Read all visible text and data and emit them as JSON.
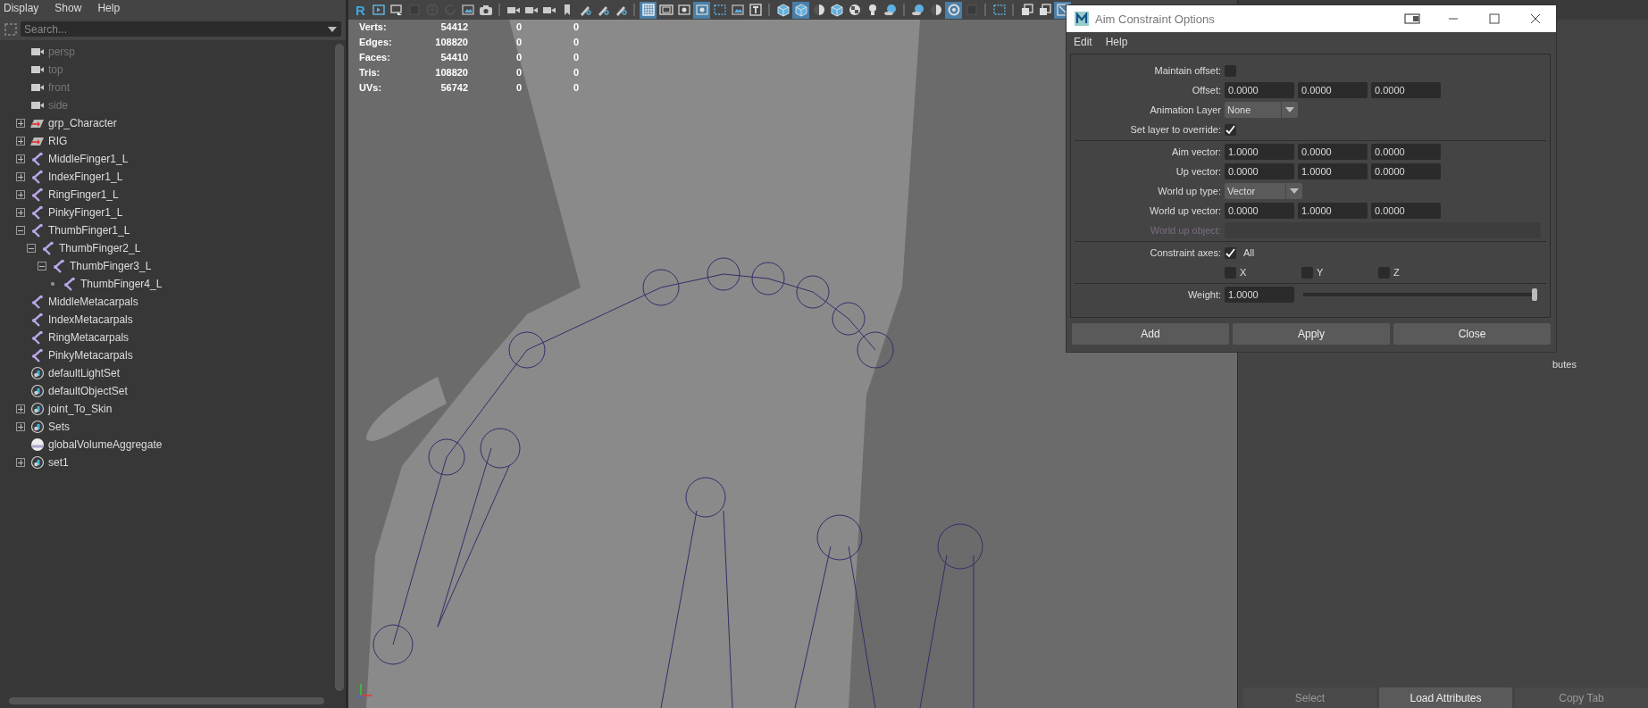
{
  "outliner": {
    "menu": [
      "Display",
      "Show",
      "Help"
    ],
    "search": {
      "placeholder": "Search..."
    },
    "items": [
      {
        "kind": "camera",
        "label": "persp",
        "dimmed": true
      },
      {
        "kind": "camera",
        "label": "top",
        "dimmed": true
      },
      {
        "kind": "camera",
        "label": "front",
        "dimmed": true
      },
      {
        "kind": "camera",
        "label": "side",
        "dimmed": true
      },
      {
        "kind": "group",
        "label": "grp_Character",
        "dimmed": false,
        "expanded": false
      },
      {
        "kind": "group",
        "label": "RIG",
        "dimmed": false,
        "expanded": false
      },
      {
        "kind": "joint",
        "label": "MiddleFinger1_L",
        "dimmed": false,
        "expanded": false
      },
      {
        "kind": "joint",
        "label": "IndexFinger1_L",
        "dimmed": false,
        "expanded": false
      },
      {
        "kind": "joint",
        "label": "RingFinger1_L",
        "dimmed": false,
        "expanded": false
      },
      {
        "kind": "joint",
        "label": "PinkyFinger1_L",
        "dimmed": false,
        "expanded": false
      },
      {
        "kind": "joint",
        "label": "ThumbFinger1_L",
        "dimmed": false,
        "expanded": true,
        "children": [
          {
            "kind": "joint",
            "label": "ThumbFinger2_L",
            "dimmed": false,
            "expanded": true,
            "children": [
              {
                "kind": "joint",
                "label": "ThumbFinger3_L",
                "dimmed": false,
                "expanded": true,
                "children": [
                  {
                    "kind": "joint",
                    "label": "ThumbFinger4_L",
                    "dimmed": false
                  }
                ]
              }
            ]
          }
        ]
      },
      {
        "kind": "joint",
        "label": "MiddleMetacarpals",
        "dimmed": false
      },
      {
        "kind": "joint",
        "label": "IndexMetacarpals",
        "dimmed": false
      },
      {
        "kind": "joint",
        "label": "RingMetacarpals",
        "dimmed": false
      },
      {
        "kind": "joint",
        "label": "PinkyMetacarpals",
        "dimmed": false
      },
      {
        "kind": "set",
        "label": "defaultLightSet",
        "dimmed": false
      },
      {
        "kind": "set",
        "label": "defaultObjectSet",
        "dimmed": false
      },
      {
        "kind": "set",
        "label": "joint_To_Skin",
        "dimmed": false,
        "expanded": false
      },
      {
        "kind": "set",
        "label": "Sets",
        "dimmed": false,
        "expanded": false
      },
      {
        "kind": "volume",
        "label": "globalVolumeAggregate",
        "dimmed": false
      },
      {
        "kind": "set",
        "label": "set1",
        "dimmed": false,
        "expanded": false
      }
    ]
  },
  "viewport": {
    "toolbar": [
      {
        "kind": "glyph",
        "label": "R",
        "selected": false
      },
      {
        "kind": "play",
        "selected": false
      },
      {
        "kind": "monitor",
        "selected": false
      },
      {
        "kind": "square",
        "selected": false
      },
      {
        "kind": "globe",
        "selected": false
      },
      {
        "kind": "refresh",
        "selected": false
      },
      {
        "kind": "image",
        "selected": false
      },
      {
        "kind": "photo",
        "selected": false
      },
      {
        "kind": "sep"
      },
      {
        "kind": "camera",
        "selected": false
      },
      {
        "kind": "camera",
        "selected": false
      },
      {
        "kind": "camera",
        "selected": false
      },
      {
        "kind": "bookmark",
        "selected": false
      },
      {
        "kind": "pen",
        "selected": false
      },
      {
        "kind": "pen",
        "selected": false
      },
      {
        "kind": "pen",
        "selected": false
      },
      {
        "kind": "sep"
      },
      {
        "kind": "grid",
        "selected": true
      },
      {
        "kind": "film",
        "selected": false
      },
      {
        "kind": "circle",
        "selected": false
      },
      {
        "kind": "circle",
        "selected": true
      },
      {
        "kind": "dashed",
        "selected": false
      },
      {
        "kind": "image",
        "selected": false
      },
      {
        "kind": "framed-t",
        "selected": false
      },
      {
        "kind": "sep"
      },
      {
        "kind": "cube",
        "selected": false
      },
      {
        "kind": "cube",
        "selected": true
      },
      {
        "kind": "half",
        "selected": false
      },
      {
        "kind": "cube",
        "selected": false
      },
      {
        "kind": "checker",
        "selected": false
      },
      {
        "kind": "bulb",
        "selected": false
      },
      {
        "kind": "sphere",
        "selected": false
      },
      {
        "kind": "sep"
      },
      {
        "kind": "sphere",
        "selected": false
      },
      {
        "kind": "half",
        "selected": false
      },
      {
        "kind": "ring",
        "selected": true
      },
      {
        "kind": "square",
        "selected": false
      },
      {
        "kind": "sep"
      },
      {
        "kind": "dashed",
        "selected": false
      },
      {
        "kind": "sep"
      },
      {
        "kind": "stack",
        "selected": false
      },
      {
        "kind": "stack",
        "selected": false
      },
      {
        "kind": "frame",
        "selected": true
      }
    ],
    "hud": [
      {
        "label": "Verts:",
        "values": [
          "54412",
          "0",
          "0"
        ]
      },
      {
        "label": "Edges:",
        "values": [
          "108820",
          "0",
          "0"
        ]
      },
      {
        "label": "Faces:",
        "values": [
          "54410",
          "0",
          "0"
        ]
      },
      {
        "label": "Tris:",
        "values": [
          "108820",
          "0",
          "0"
        ]
      },
      {
        "label": "UVs:",
        "values": [
          "56742",
          "0",
          "0"
        ]
      }
    ]
  },
  "right_panel": {
    "partial_label": "butes",
    "buttons": [
      {
        "label": "Select",
        "disabled": true
      },
      {
        "label": "Load Attributes",
        "disabled": false
      },
      {
        "label": "Copy Tab",
        "disabled": true
      }
    ]
  },
  "dialog": {
    "title": "Aim Constraint Options",
    "menu": [
      "Edit",
      "Help"
    ],
    "sections": [
      {
        "rows": [
          {
            "kind": "checkbox",
            "label": "Maintain offset:",
            "checked": false
          },
          {
            "kind": "vector",
            "label": "Offset:",
            "values": [
              "0.0000",
              "0.0000",
              "0.0000"
            ]
          },
          {
            "kind": "dropdown",
            "label": "Animation Layer",
            "value": "None"
          },
          {
            "kind": "checkbox",
            "label": "Set layer to override:",
            "checked": true
          }
        ]
      },
      {
        "rows": [
          {
            "kind": "vector",
            "label": "Aim vector:",
            "values": [
              "1.0000",
              "0.0000",
              "0.0000"
            ]
          },
          {
            "kind": "vector",
            "label": "Up vector:",
            "values": [
              "0.0000",
              "1.0000",
              "0.0000"
            ]
          },
          {
            "kind": "dropdown",
            "label": "World up type:",
            "value": "Vector"
          },
          {
            "kind": "vector",
            "label": "World up vector:",
            "values": [
              "0.0000",
              "1.0000",
              "0.0000"
            ]
          },
          {
            "kind": "object",
            "label": "World up object:",
            "disabled": true
          }
        ]
      },
      {
        "rows": [
          {
            "kind": "checkbox",
            "label": "Constraint axes:",
            "checked": true,
            "option": "All"
          },
          {
            "kind": "axes",
            "options": [
              {
                "label": "X",
                "checked": false
              },
              {
                "label": "Y",
                "checked": false
              },
              {
                "label": "Z",
                "checked": false
              }
            ]
          }
        ]
      },
      {
        "rows": [
          {
            "kind": "slider",
            "label": "Weight:",
            "value": "1.0000",
            "level": 1
          }
        ]
      }
    ],
    "buttons": [
      "Add",
      "Apply",
      "Close"
    ]
  }
}
